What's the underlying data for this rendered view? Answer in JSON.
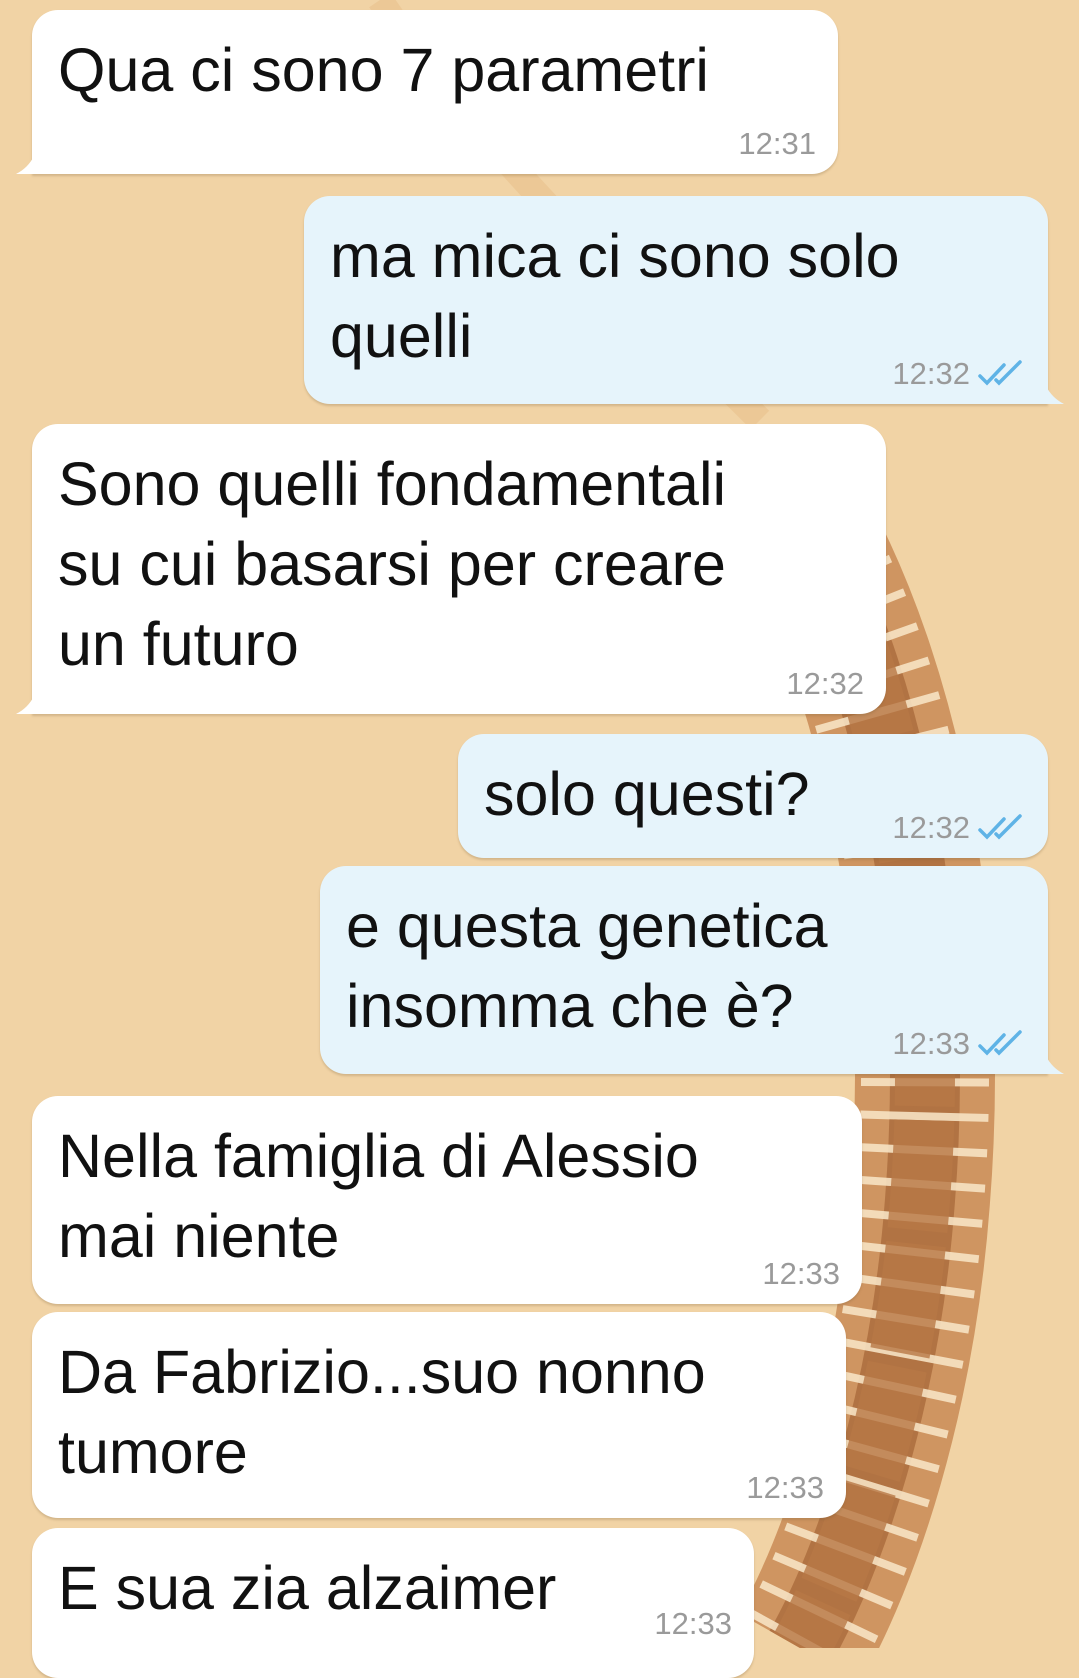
{
  "theme": {
    "wallpaper": "#f1d3a5",
    "incoming_bubble": "#ffffff",
    "outgoing_bubble": "#e6f4fb",
    "read_ticks": "#5fb3e6",
    "time_color": "#9a9a9a"
  },
  "messages": [
    {
      "direction": "in",
      "text": "Qua ci sono 7 parametri",
      "time": "12:31"
    },
    {
      "direction": "out",
      "text": "ma mica ci sono solo\nquelli",
      "time": "12:32",
      "status": "read-double-check-icon"
    },
    {
      "direction": "in",
      "text": "Sono quelli fondamentali\nsu cui basarsi per creare\nun futuro",
      "time": "12:32"
    },
    {
      "direction": "out",
      "text": "solo questi?",
      "time": "12:32",
      "status": "read-double-check-icon"
    },
    {
      "direction": "out",
      "text": "e questa genetica\ninsomma che è?",
      "time": "12:33",
      "status": "read-double-check-icon"
    },
    {
      "direction": "in",
      "text": "Nella famiglia di Alessio\nmai niente",
      "time": "12:33"
    },
    {
      "direction": "in",
      "text": "Da Fabrizio...suo nonno\ntumore",
      "time": "12:33"
    },
    {
      "direction": "in",
      "text": "E sua zia alzaimer",
      "time": "12:33"
    }
  ]
}
